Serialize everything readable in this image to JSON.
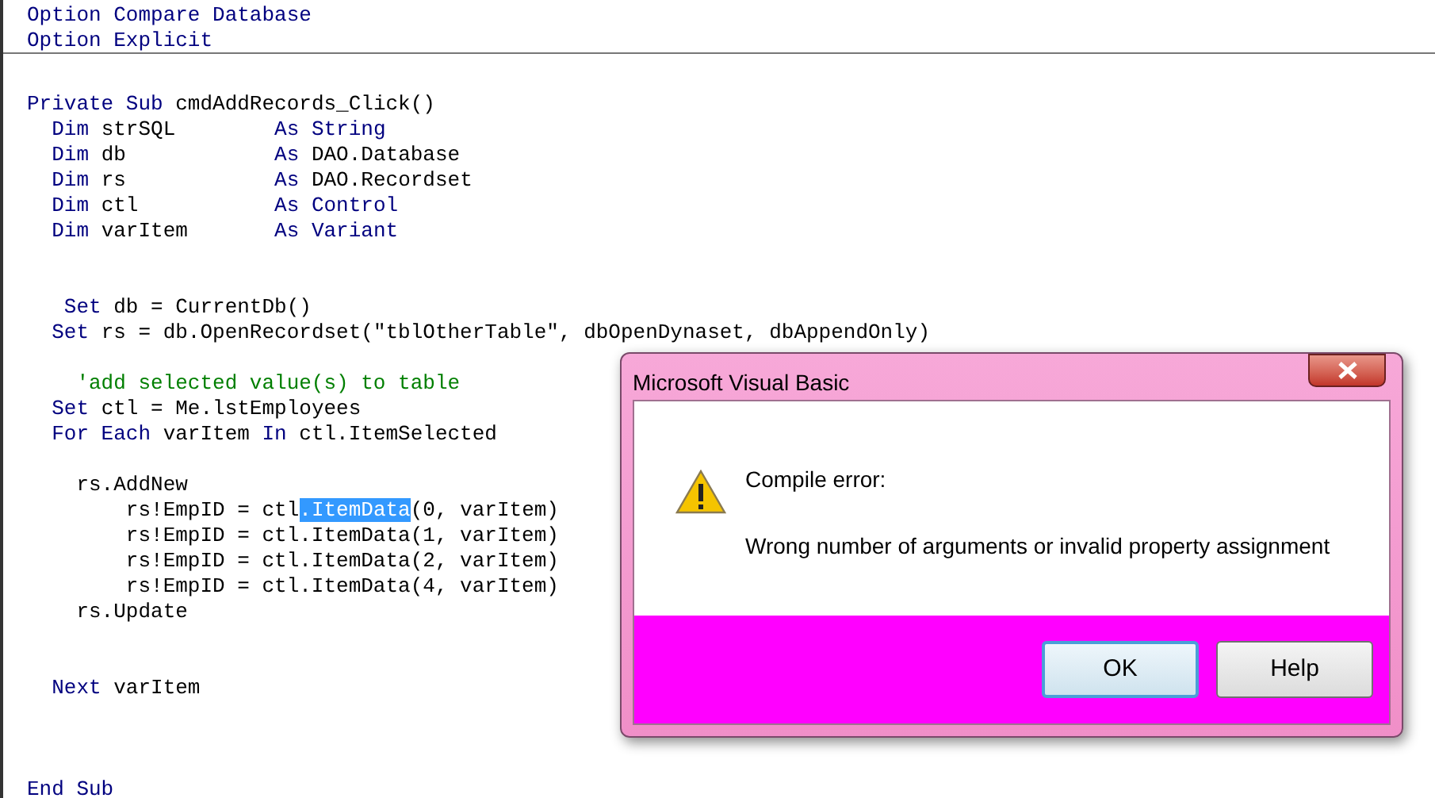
{
  "editor": {
    "lines": [
      {
        "kind": "code",
        "segments": [
          {
            "text": "Option Compare Database",
            "kind": "keyword"
          }
        ]
      },
      {
        "kind": "code",
        "segments": [
          {
            "text": "Option Explicit",
            "kind": "keyword"
          }
        ]
      },
      {
        "kind": "separator"
      },
      {
        "kind": "blank"
      },
      {
        "kind": "code",
        "segments": [
          {
            "text": "Private Sub",
            "kind": "keyword"
          },
          {
            "text": " cmdAddRecords_Click()",
            "kind": "plain"
          }
        ]
      },
      {
        "kind": "code",
        "segments": [
          {
            "text": "  Dim",
            "kind": "keyword"
          },
          {
            "text": " strSQL        ",
            "kind": "plain"
          },
          {
            "text": "As String",
            "kind": "keyword"
          }
        ]
      },
      {
        "kind": "code",
        "segments": [
          {
            "text": "  Dim",
            "kind": "keyword"
          },
          {
            "text": " db            ",
            "kind": "plain"
          },
          {
            "text": "As",
            "kind": "keyword"
          },
          {
            "text": " DAO.Database",
            "kind": "plain"
          }
        ]
      },
      {
        "kind": "code",
        "segments": [
          {
            "text": "  Dim",
            "kind": "keyword"
          },
          {
            "text": " rs            ",
            "kind": "plain"
          },
          {
            "text": "As",
            "kind": "keyword"
          },
          {
            "text": " DAO.Recordset",
            "kind": "plain"
          }
        ]
      },
      {
        "kind": "code",
        "segments": [
          {
            "text": "  Dim",
            "kind": "keyword"
          },
          {
            "text": " ctl           ",
            "kind": "plain"
          },
          {
            "text": "As Control",
            "kind": "keyword"
          }
        ]
      },
      {
        "kind": "code",
        "segments": [
          {
            "text": "  Dim",
            "kind": "keyword"
          },
          {
            "text": " varItem       ",
            "kind": "plain"
          },
          {
            "text": "As Variant",
            "kind": "keyword"
          }
        ]
      },
      {
        "kind": "blank"
      },
      {
        "kind": "blank"
      },
      {
        "kind": "code",
        "segments": [
          {
            "text": "   Set",
            "kind": "keyword"
          },
          {
            "text": " db = CurrentDb()",
            "kind": "plain"
          }
        ]
      },
      {
        "kind": "code",
        "segments": [
          {
            "text": "  Set",
            "kind": "keyword"
          },
          {
            "text": " rs = db.OpenRecordset(\"tblOtherTable\", dbOpenDynaset, dbAppendOnly)",
            "kind": "plain"
          }
        ]
      },
      {
        "kind": "blank"
      },
      {
        "kind": "code",
        "segments": [
          {
            "text": "    'add selected value(s) to table",
            "kind": "comment"
          }
        ]
      },
      {
        "kind": "code",
        "segments": [
          {
            "text": "  Set",
            "kind": "keyword"
          },
          {
            "text": " ctl = Me.lstEmployees",
            "kind": "plain"
          }
        ]
      },
      {
        "kind": "code",
        "segments": [
          {
            "text": "  For Each",
            "kind": "keyword"
          },
          {
            "text": " varItem ",
            "kind": "plain"
          },
          {
            "text": "In",
            "kind": "keyword"
          },
          {
            "text": " ctl.ItemSelected",
            "kind": "plain"
          }
        ]
      },
      {
        "kind": "blank"
      },
      {
        "kind": "code",
        "segments": [
          {
            "text": "    rs.AddNew",
            "kind": "plain"
          }
        ]
      },
      {
        "kind": "code",
        "segments": [
          {
            "text": "        rs!EmpID = ctl",
            "kind": "plain"
          },
          {
            "text": ".ItemData",
            "kind": "selected"
          },
          {
            "text": "(0, varItem)",
            "kind": "plain"
          }
        ]
      },
      {
        "kind": "code",
        "segments": [
          {
            "text": "        rs!EmpID = ctl.ItemData(1, varItem)",
            "kind": "plain"
          }
        ]
      },
      {
        "kind": "code",
        "segments": [
          {
            "text": "        rs!EmpID = ctl.ItemData(2, varItem)",
            "kind": "plain"
          }
        ]
      },
      {
        "kind": "code",
        "segments": [
          {
            "text": "        rs!EmpID = ctl.ItemData(4, varItem)",
            "kind": "plain"
          }
        ]
      },
      {
        "kind": "code",
        "segments": [
          {
            "text": "    rs.Update",
            "kind": "plain"
          }
        ]
      },
      {
        "kind": "blank"
      },
      {
        "kind": "blank"
      },
      {
        "kind": "code",
        "segments": [
          {
            "text": "  Next",
            "kind": "keyword"
          },
          {
            "text": " varItem",
            "kind": "plain"
          }
        ]
      },
      {
        "kind": "blank"
      },
      {
        "kind": "blank"
      },
      {
        "kind": "blank"
      },
      {
        "kind": "code",
        "segments": [
          {
            "text": "End Sub",
            "kind": "keyword"
          }
        ]
      }
    ]
  },
  "dialog": {
    "title": "Microsoft Visual Basic",
    "heading": "Compile error:",
    "message": "Wrong number of arguments or invalid property assignment",
    "buttons": [
      {
        "label": "OK",
        "default": true
      },
      {
        "label": "Help",
        "default": false
      }
    ]
  }
}
